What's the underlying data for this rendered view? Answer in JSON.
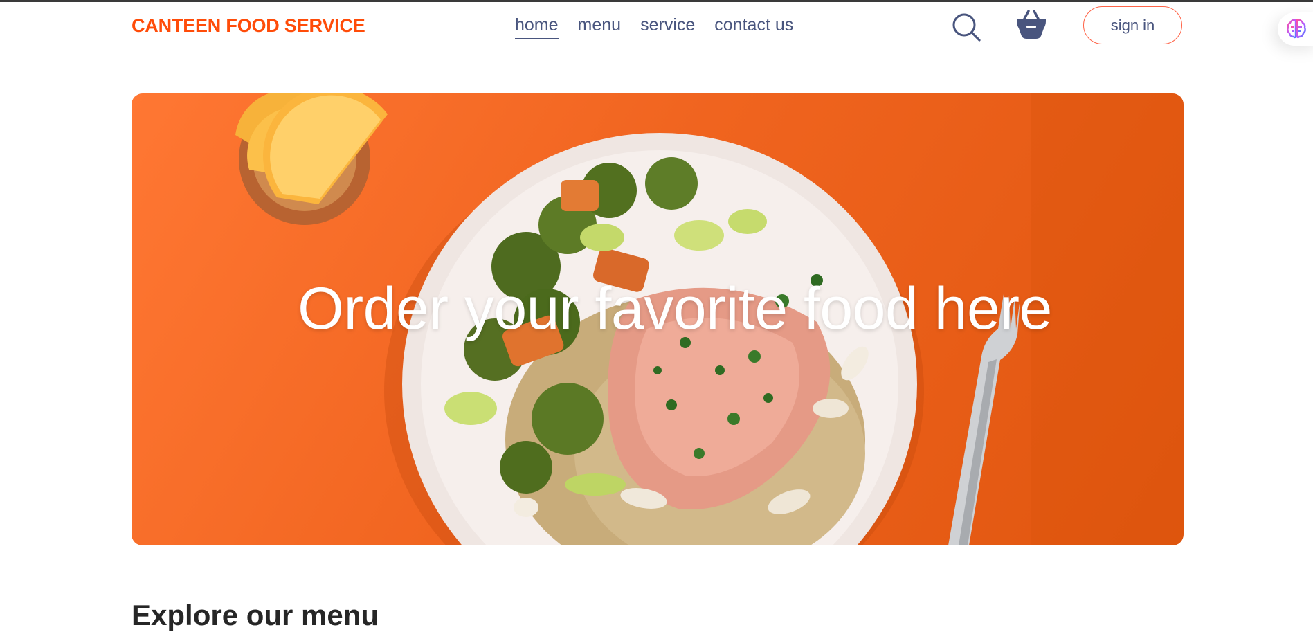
{
  "brand": {
    "name": "CANTEEN FOOD SERVICE",
    "color": "#ff4c09"
  },
  "nav": {
    "items": [
      {
        "label": "home",
        "active": true
      },
      {
        "label": "menu",
        "active": false
      },
      {
        "label": "service",
        "active": false
      },
      {
        "label": "contact us",
        "active": false
      }
    ]
  },
  "header": {
    "search_icon": "search-icon",
    "basket_icon": "basket-icon",
    "signin_label": "sign in",
    "extension_icon": "brain-icon"
  },
  "hero": {
    "title": "Order your favorite food here",
    "background_color": "#f0641f",
    "image": "plate-of-salmon-with-broccoli-and-quinoa"
  },
  "section": {
    "title": "Explore our menu"
  },
  "colors": {
    "accent": "#ff4c09",
    "nav_text": "#49557e",
    "button_border": "#ff6347"
  }
}
